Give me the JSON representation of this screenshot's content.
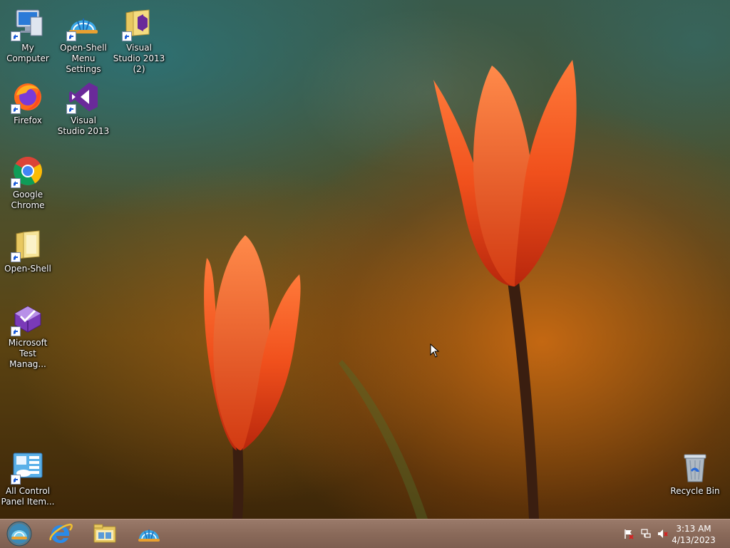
{
  "desktop": {
    "icons": [
      {
        "label": "My Computer",
        "icon": "computer-icon"
      },
      {
        "label": "Open-Shell Menu Settings",
        "icon": "open-shell-shell-icon"
      },
      {
        "label": "Visual Studio 2013 (2)",
        "icon": "folder-visual-studio-icon"
      },
      {
        "label": "Firefox",
        "icon": "firefox-icon"
      },
      {
        "label": "Visual Studio 2013",
        "icon": "visual-studio-icon"
      },
      {
        "label": "Google Chrome",
        "icon": "chrome-icon"
      },
      {
        "label": "Open-Shell",
        "icon": "folder-icon"
      },
      {
        "label": "Microsoft Test Manag...",
        "icon": "test-manager-icon"
      },
      {
        "label": "All Control Panel Item...",
        "icon": "control-panel-icon"
      },
      {
        "label": "Recycle Bin",
        "icon": "recycle-bin-icon"
      }
    ]
  },
  "taskbar": {
    "start_button": {
      "icon": "start-orb-icon"
    },
    "pinned": [
      {
        "icon": "internet-explorer-icon"
      },
      {
        "icon": "file-explorer-icon"
      },
      {
        "icon": "open-shell-shell-icon"
      }
    ],
    "tray": {
      "icons": [
        "action-center-flag-icon",
        "network-icon",
        "volume-muted-icon"
      ],
      "time": "3:13 AM",
      "date": "4/13/2023"
    }
  },
  "colors": {
    "taskbar": "#8a6a5a",
    "tulip": "#e8461a",
    "wallpaper_teal": "#2e7a80",
    "wallpaper_amber": "#c8701a"
  }
}
